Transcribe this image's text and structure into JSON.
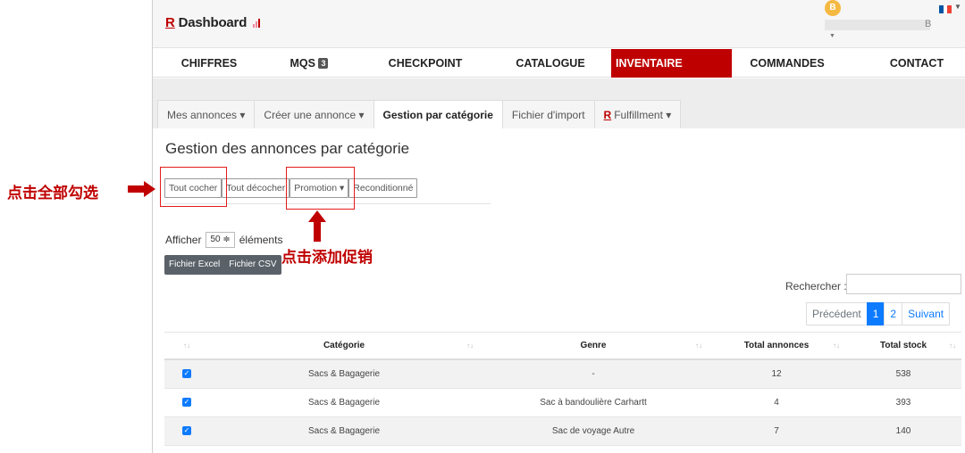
{
  "header": {
    "logo_r": "R",
    "logo_text": "Dashboard",
    "avatar_letter": "B",
    "user_suffix": "B",
    "flag_colors": [
      "#0055a4",
      "#ffffff",
      "#ef4135"
    ]
  },
  "nav": {
    "items": [
      "CHIFFRES",
      "MQS",
      "CHECKPOINT",
      "CATALOGUE",
      "INVENTAIRE",
      "COMMANDES",
      "CONTACT"
    ],
    "mqs_badge": "3",
    "active": "INVENTAIRE"
  },
  "tabs": [
    {
      "label": "Mes annonces ▾"
    },
    {
      "label": "Créer une annonce ▾"
    },
    {
      "label": "Gestion par catégorie"
    },
    {
      "label": "Fichier d'import"
    },
    {
      "label": "Fulfillment ▾",
      "prefix": "R"
    }
  ],
  "page": {
    "title": "Gestion des annonces par catégorie"
  },
  "actions": {
    "check_all": "Tout cocher",
    "uncheck_all": "Tout décocher",
    "promotion": "Promotion ▾",
    "refurbished": "Reconditionné"
  },
  "length": {
    "prefix": "Afficher",
    "value": "50 ≑",
    "suffix": "éléments"
  },
  "exports": {
    "excel": "Fichier Excel",
    "csv": "Fichier CSV"
  },
  "search": {
    "label": "Rechercher :",
    "value": ""
  },
  "pagination": {
    "prev": "Précédent",
    "pages": [
      "1",
      "2"
    ],
    "next": "Suivant",
    "current": "1"
  },
  "table": {
    "headers": [
      "↑↓",
      "Catégorie",
      "Genre",
      "Total annonces",
      "Total stock"
    ],
    "rows": [
      {
        "category": "Sacs & Bagagerie",
        "genre": "-",
        "total_annonces": "12",
        "total_stock": "538"
      },
      {
        "category": "Sacs & Bagagerie",
        "genre": "Sac à bandoulière Carhartt",
        "total_annonces": "4",
        "total_stock": "393"
      },
      {
        "category": "Sacs & Bagagerie",
        "genre": "Sac de voyage Autre",
        "total_annonces": "7",
        "total_stock": "140"
      }
    ]
  },
  "annotations": {
    "left_text": "点击全部勾选",
    "middle_text": "点击添加促销",
    "color": "#c00000"
  }
}
